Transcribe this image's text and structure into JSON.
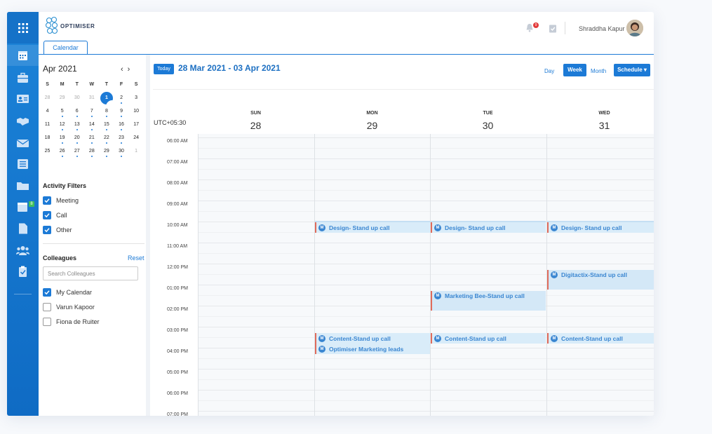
{
  "app": {
    "brand": "OPTIMISER",
    "tab": "Calendar"
  },
  "header": {
    "user_name": "Shraddha Kapur",
    "notification_count": "9"
  },
  "rail": {
    "icons": [
      "apps-grid-icon",
      "calendar-icon",
      "briefcase-icon",
      "contact-card-icon",
      "handshake-icon",
      "mail-icon",
      "list-icon",
      "folder-icon",
      "activity-calendar-icon",
      "document-icon",
      "team-icon",
      "clipboard-icon"
    ],
    "badge": "8"
  },
  "mini_calendar": {
    "title": "Apr 2021",
    "weekday_headers": [
      "S",
      "M",
      "T",
      "W",
      "T",
      "F",
      "S"
    ],
    "weeks": [
      [
        "28",
        "29",
        "30",
        "31",
        "1",
        "2",
        "3"
      ],
      [
        "4",
        "5",
        "6",
        "7",
        "8",
        "9",
        "10"
      ],
      [
        "11",
        "12",
        "13",
        "14",
        "15",
        "16",
        "17"
      ],
      [
        "18",
        "19",
        "20",
        "21",
        "22",
        "23",
        "24"
      ],
      [
        "25",
        "26",
        "27",
        "28",
        "29",
        "30",
        "1"
      ]
    ]
  },
  "activity_filters": {
    "title": "Activity Filters",
    "items": [
      {
        "label": "Meeting",
        "checked": true
      },
      {
        "label": "Call",
        "checked": true
      },
      {
        "label": "Other",
        "checked": true
      }
    ]
  },
  "colleagues": {
    "title": "Colleagues",
    "reset_label": "Reset",
    "search_placeholder": "Search Colleagues",
    "items": [
      {
        "label": "My Calendar",
        "checked": true
      },
      {
        "label": "Varun Kapoor",
        "checked": false
      },
      {
        "label": "Fiona de Ruiter",
        "checked": false
      }
    ]
  },
  "toolbar": {
    "today_label": "Today",
    "date_range": "28 Mar 2021 - 03 Apr 2021",
    "view_day": "Day",
    "view_week": "Week",
    "view_month": "Month",
    "schedule_label": "Schedule ▾"
  },
  "week": {
    "timezone": "UTC+05:30",
    "days": [
      {
        "name": "SUN",
        "num": "28"
      },
      {
        "name": "MON",
        "num": "29"
      },
      {
        "name": "TUE",
        "num": "30"
      },
      {
        "name": "WED",
        "num": "31"
      }
    ],
    "times": [
      "06:00 AM",
      "07:00 AM",
      "08:00 AM",
      "09:00 AM",
      "10:00 AM",
      "11:00 AM",
      "12:00 PM",
      "01:00 PM",
      "02:00 PM",
      "03:00 PM",
      "04:00 PM",
      "05:00 PM",
      "06:00 PM",
      "07:00 PM"
    ]
  },
  "events": {
    "icon_letter": "M",
    "items": [
      {
        "title": "Design- Stand up call"
      },
      {
        "title": "Design- Stand up call"
      },
      {
        "title": "Design- Stand up call"
      },
      {
        "title": "Digitactix-Stand up call"
      },
      {
        "title": "Marketing Bee-Stand up call"
      },
      {
        "title": "Content-Stand up call"
      },
      {
        "title": "Content-Stand up call"
      },
      {
        "title": "Content-Stand up call"
      },
      {
        "title": "Optimiser Marketing leads"
      }
    ]
  },
  "colors": {
    "accent": "#1c7ad6",
    "event_bg": "#d9ecf9",
    "event_border": "#e06b5b"
  }
}
